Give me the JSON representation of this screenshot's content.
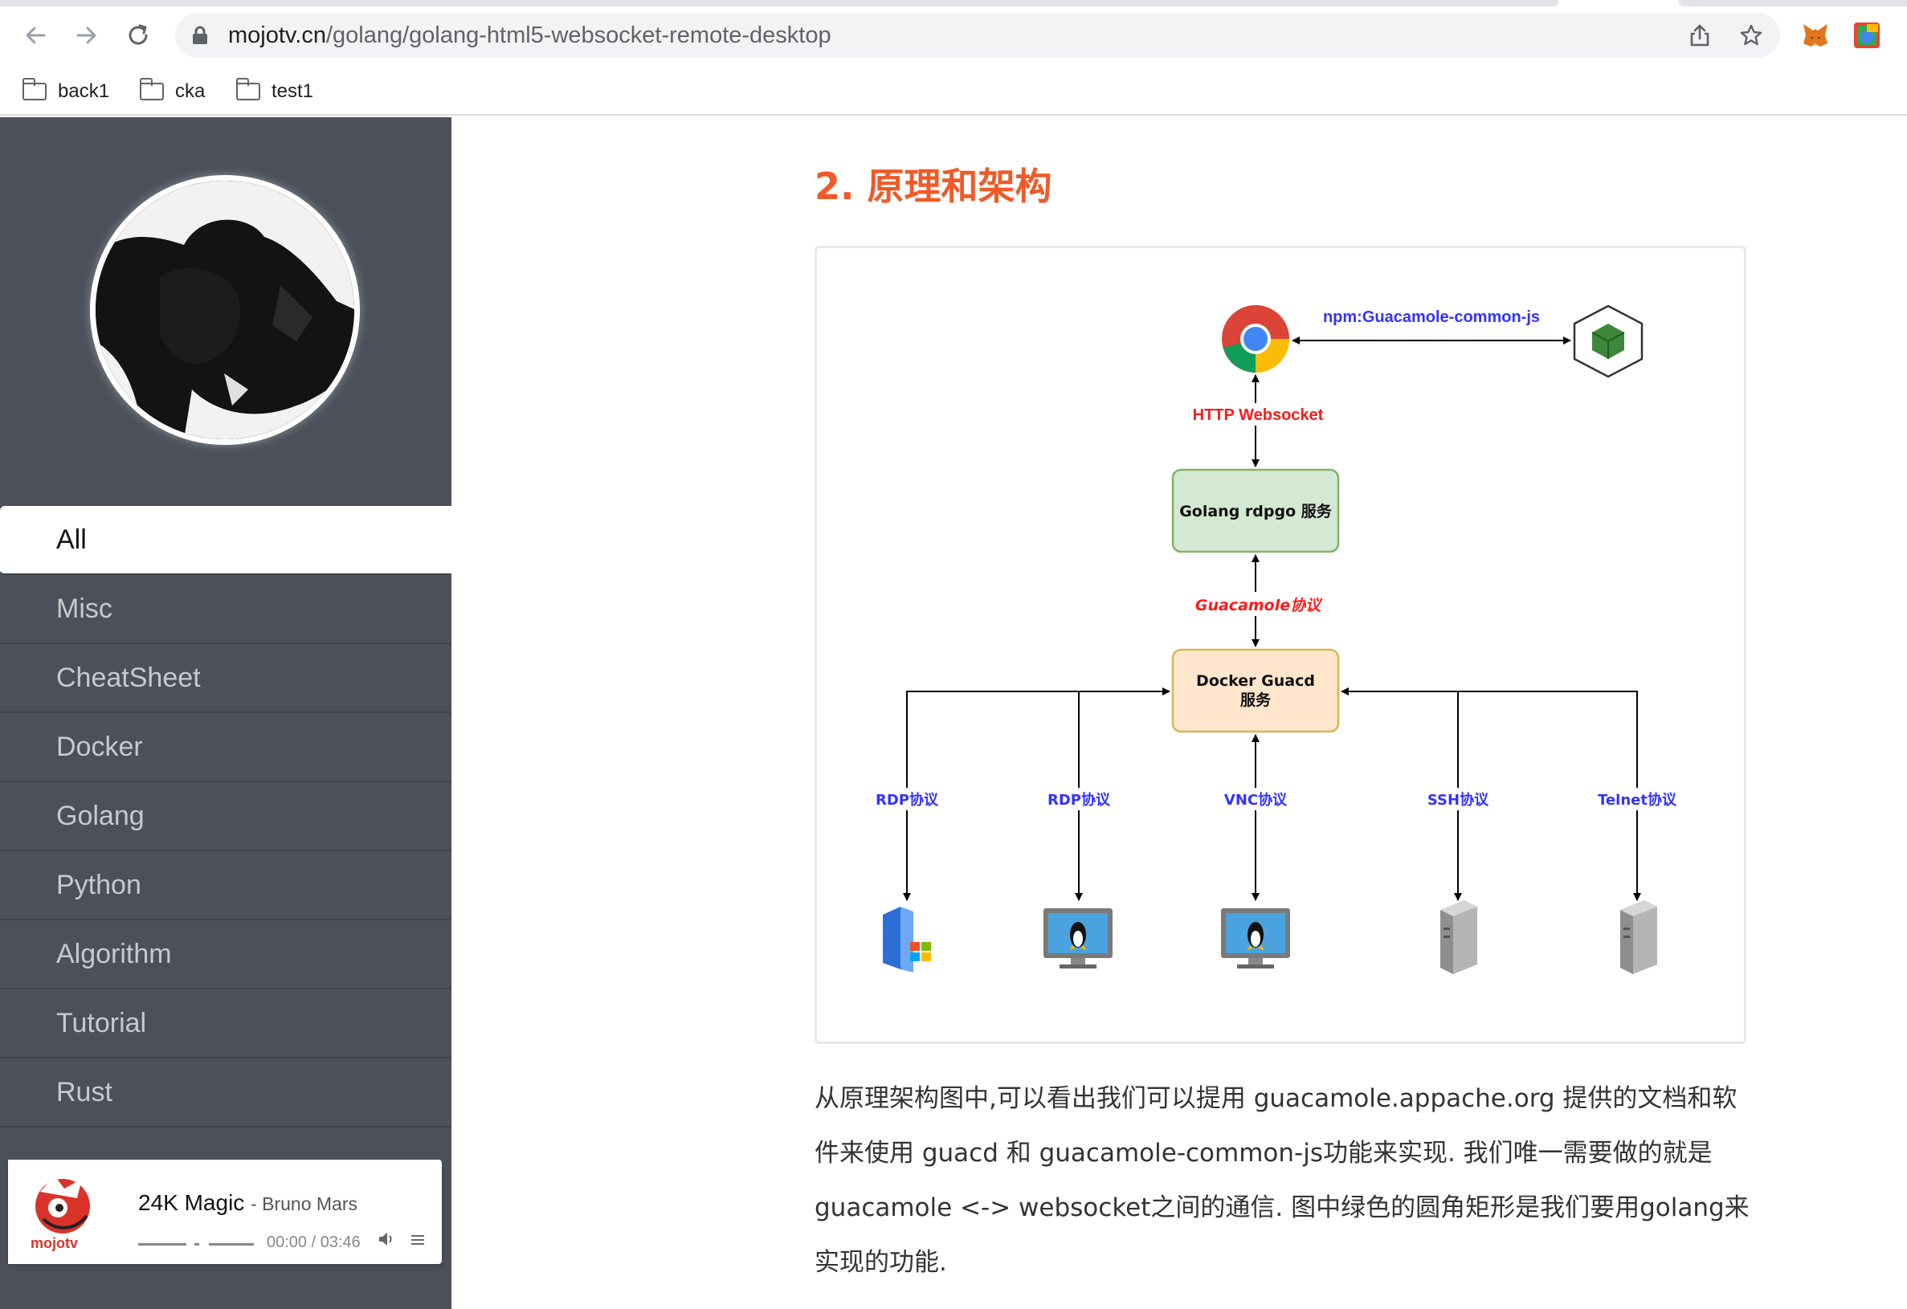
{
  "browser": {
    "url_host": "mojotv.cn",
    "url_path": "/golang/golang-html5-websocket-remote-desktop",
    "bookmarks": [
      {
        "label": "back1"
      },
      {
        "label": "cka"
      },
      {
        "label": "test1"
      }
    ]
  },
  "sidebar": {
    "nav": [
      {
        "label": "All",
        "active": true
      },
      {
        "label": "Misc"
      },
      {
        "label": "CheatSheet"
      },
      {
        "label": "Docker"
      },
      {
        "label": "Golang"
      },
      {
        "label": "Python"
      },
      {
        "label": "Algorithm"
      },
      {
        "label": "Tutorial"
      },
      {
        "label": "Rust"
      }
    ],
    "player": {
      "title": "24K Magic",
      "artist": "- Bruno Mars",
      "time": "00:00 / 03:46",
      "logo_text": "mojotv"
    }
  },
  "article": {
    "heading": "2. 原理和架构",
    "diagram": {
      "npm_label": "npm:Guacamole-common-js",
      "http_label": "HTTP Websocket",
      "golang_box": "Golang rdpgo 服务",
      "guac_label": "Guacamole协议",
      "docker_box_line1": "Docker Guacd",
      "docker_box_line2": "服务",
      "protocols": [
        "RDP协议",
        "RDP协议",
        "VNC协议",
        "SSH协议",
        "Telnet协议"
      ]
    },
    "paragraph": "从原理架构图中,可以看出我们可以提用 guacamole.appache.org 提供的文档和软件来使用 guacd 和 guacamole-common-js功能来实现. 我们唯一需要做的就是guacamole <-> websocket之间的通信. 图中绿色的圆角矩形是我们要用golang来实现的功能."
  },
  "colors": {
    "sidebar_bg": "#4b505a",
    "heading": "#f05a28",
    "green_box": "#d5e8d4",
    "orange_box": "#ffe6cc",
    "blue_label": "#3333ff",
    "red_label": "#ff1a1a"
  },
  "icons": [
    "back-arrow-icon",
    "forward-arrow-icon",
    "reload-icon",
    "lock-icon",
    "share-icon",
    "star-icon",
    "metamask-icon",
    "extension-icon",
    "folder-icon",
    "chrome-icon",
    "nodejs-icon",
    "windows-server-icon",
    "linux-desktop-icon",
    "server-icon"
  ]
}
